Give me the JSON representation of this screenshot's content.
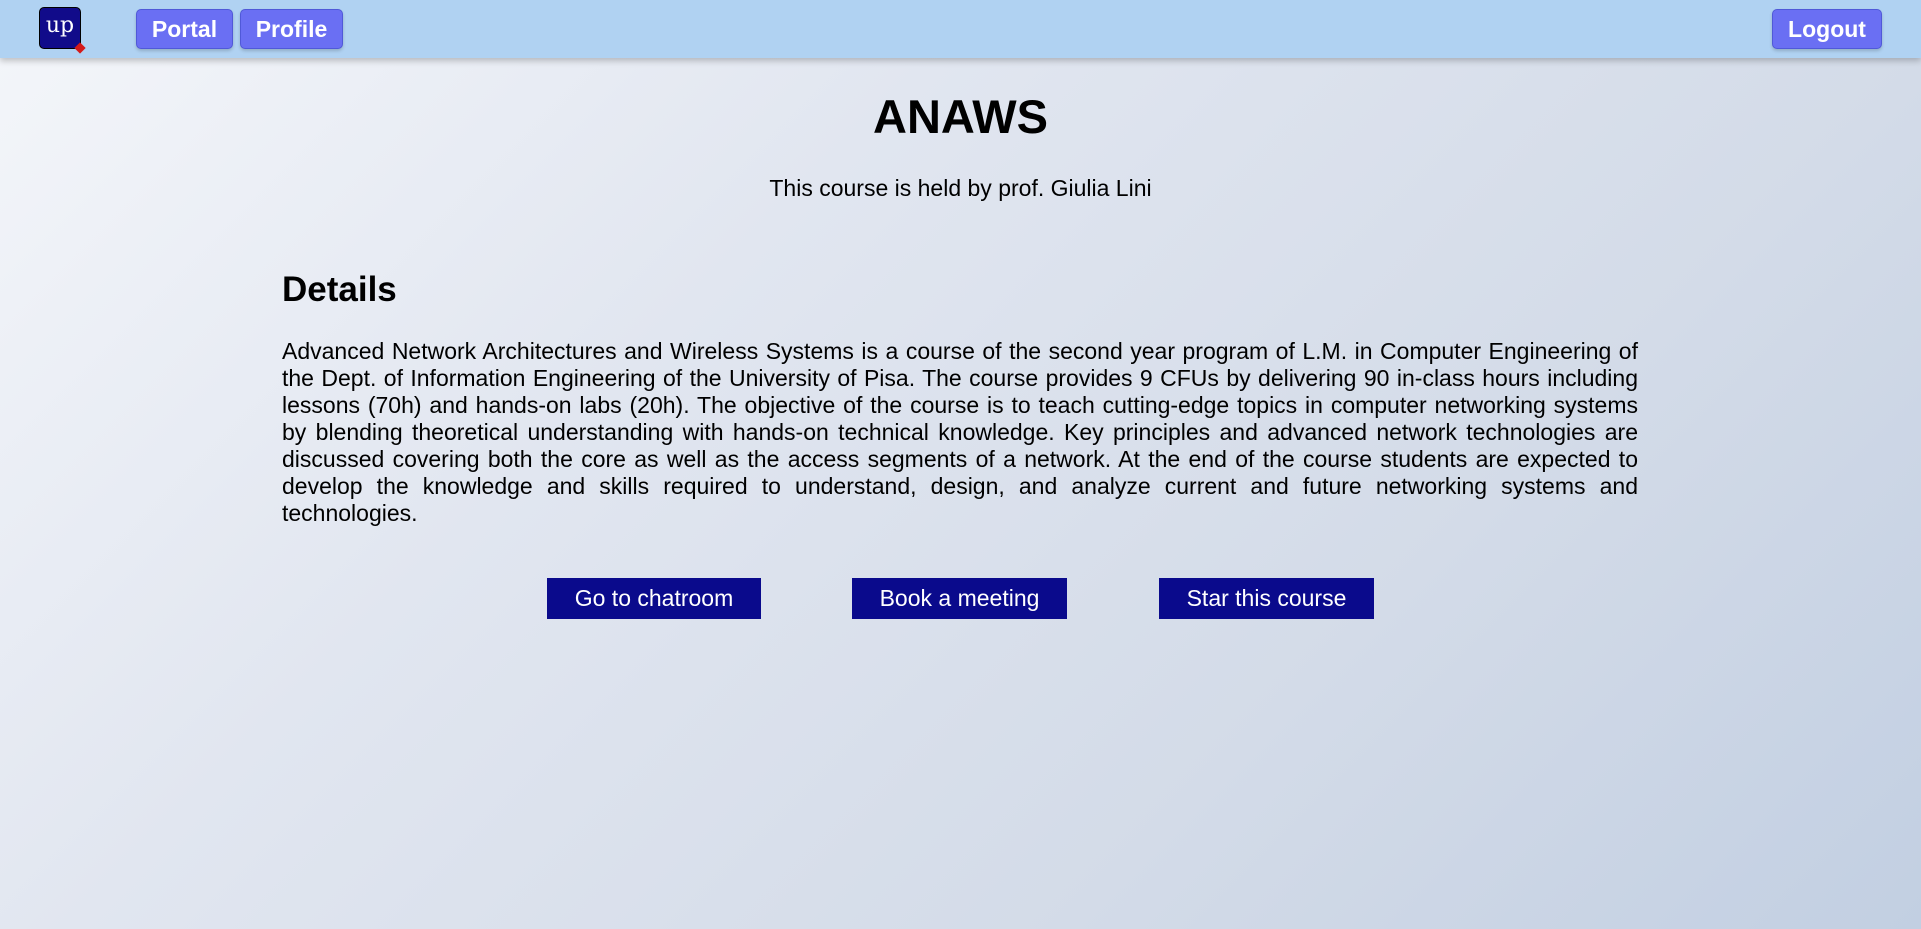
{
  "navbar": {
    "logo_text": "up",
    "portal_label": "Portal",
    "profile_label": "Profile",
    "logout_label": "Logout"
  },
  "course": {
    "title": "ANAWS",
    "subtitle": "This course is held by prof. Giulia Lini",
    "details_heading": "Details",
    "details_text": "Advanced Network Architectures and Wireless Systems is a course of the second year program of L.M. in Computer Engineering of the Dept. of Information Engineering of the University of Pisa. The course provides 9 CFUs by delivering 90 in-class hours including lessons (70h) and hands-on labs (20h). The objective of the course is to teach cutting-edge topics in computer networking systems by blending theoretical understanding with hands-on technical knowledge. Key principles and advanced network technologies are discussed covering both the core as well as the access segments of a network. At the end of the course students are expected to develop the knowledge and skills required to understand, design, and analyze current and future networking systems and technologies."
  },
  "actions": {
    "chatroom_label": "Go to chatroom",
    "meeting_label": "Book a meeting",
    "star_label": "Star this course"
  },
  "colors": {
    "navbar_bg": "#b0d2f2",
    "nav_button": "#6a6ff3",
    "action_button": "#0a0a8c",
    "logo_bg": "#110b8a"
  }
}
